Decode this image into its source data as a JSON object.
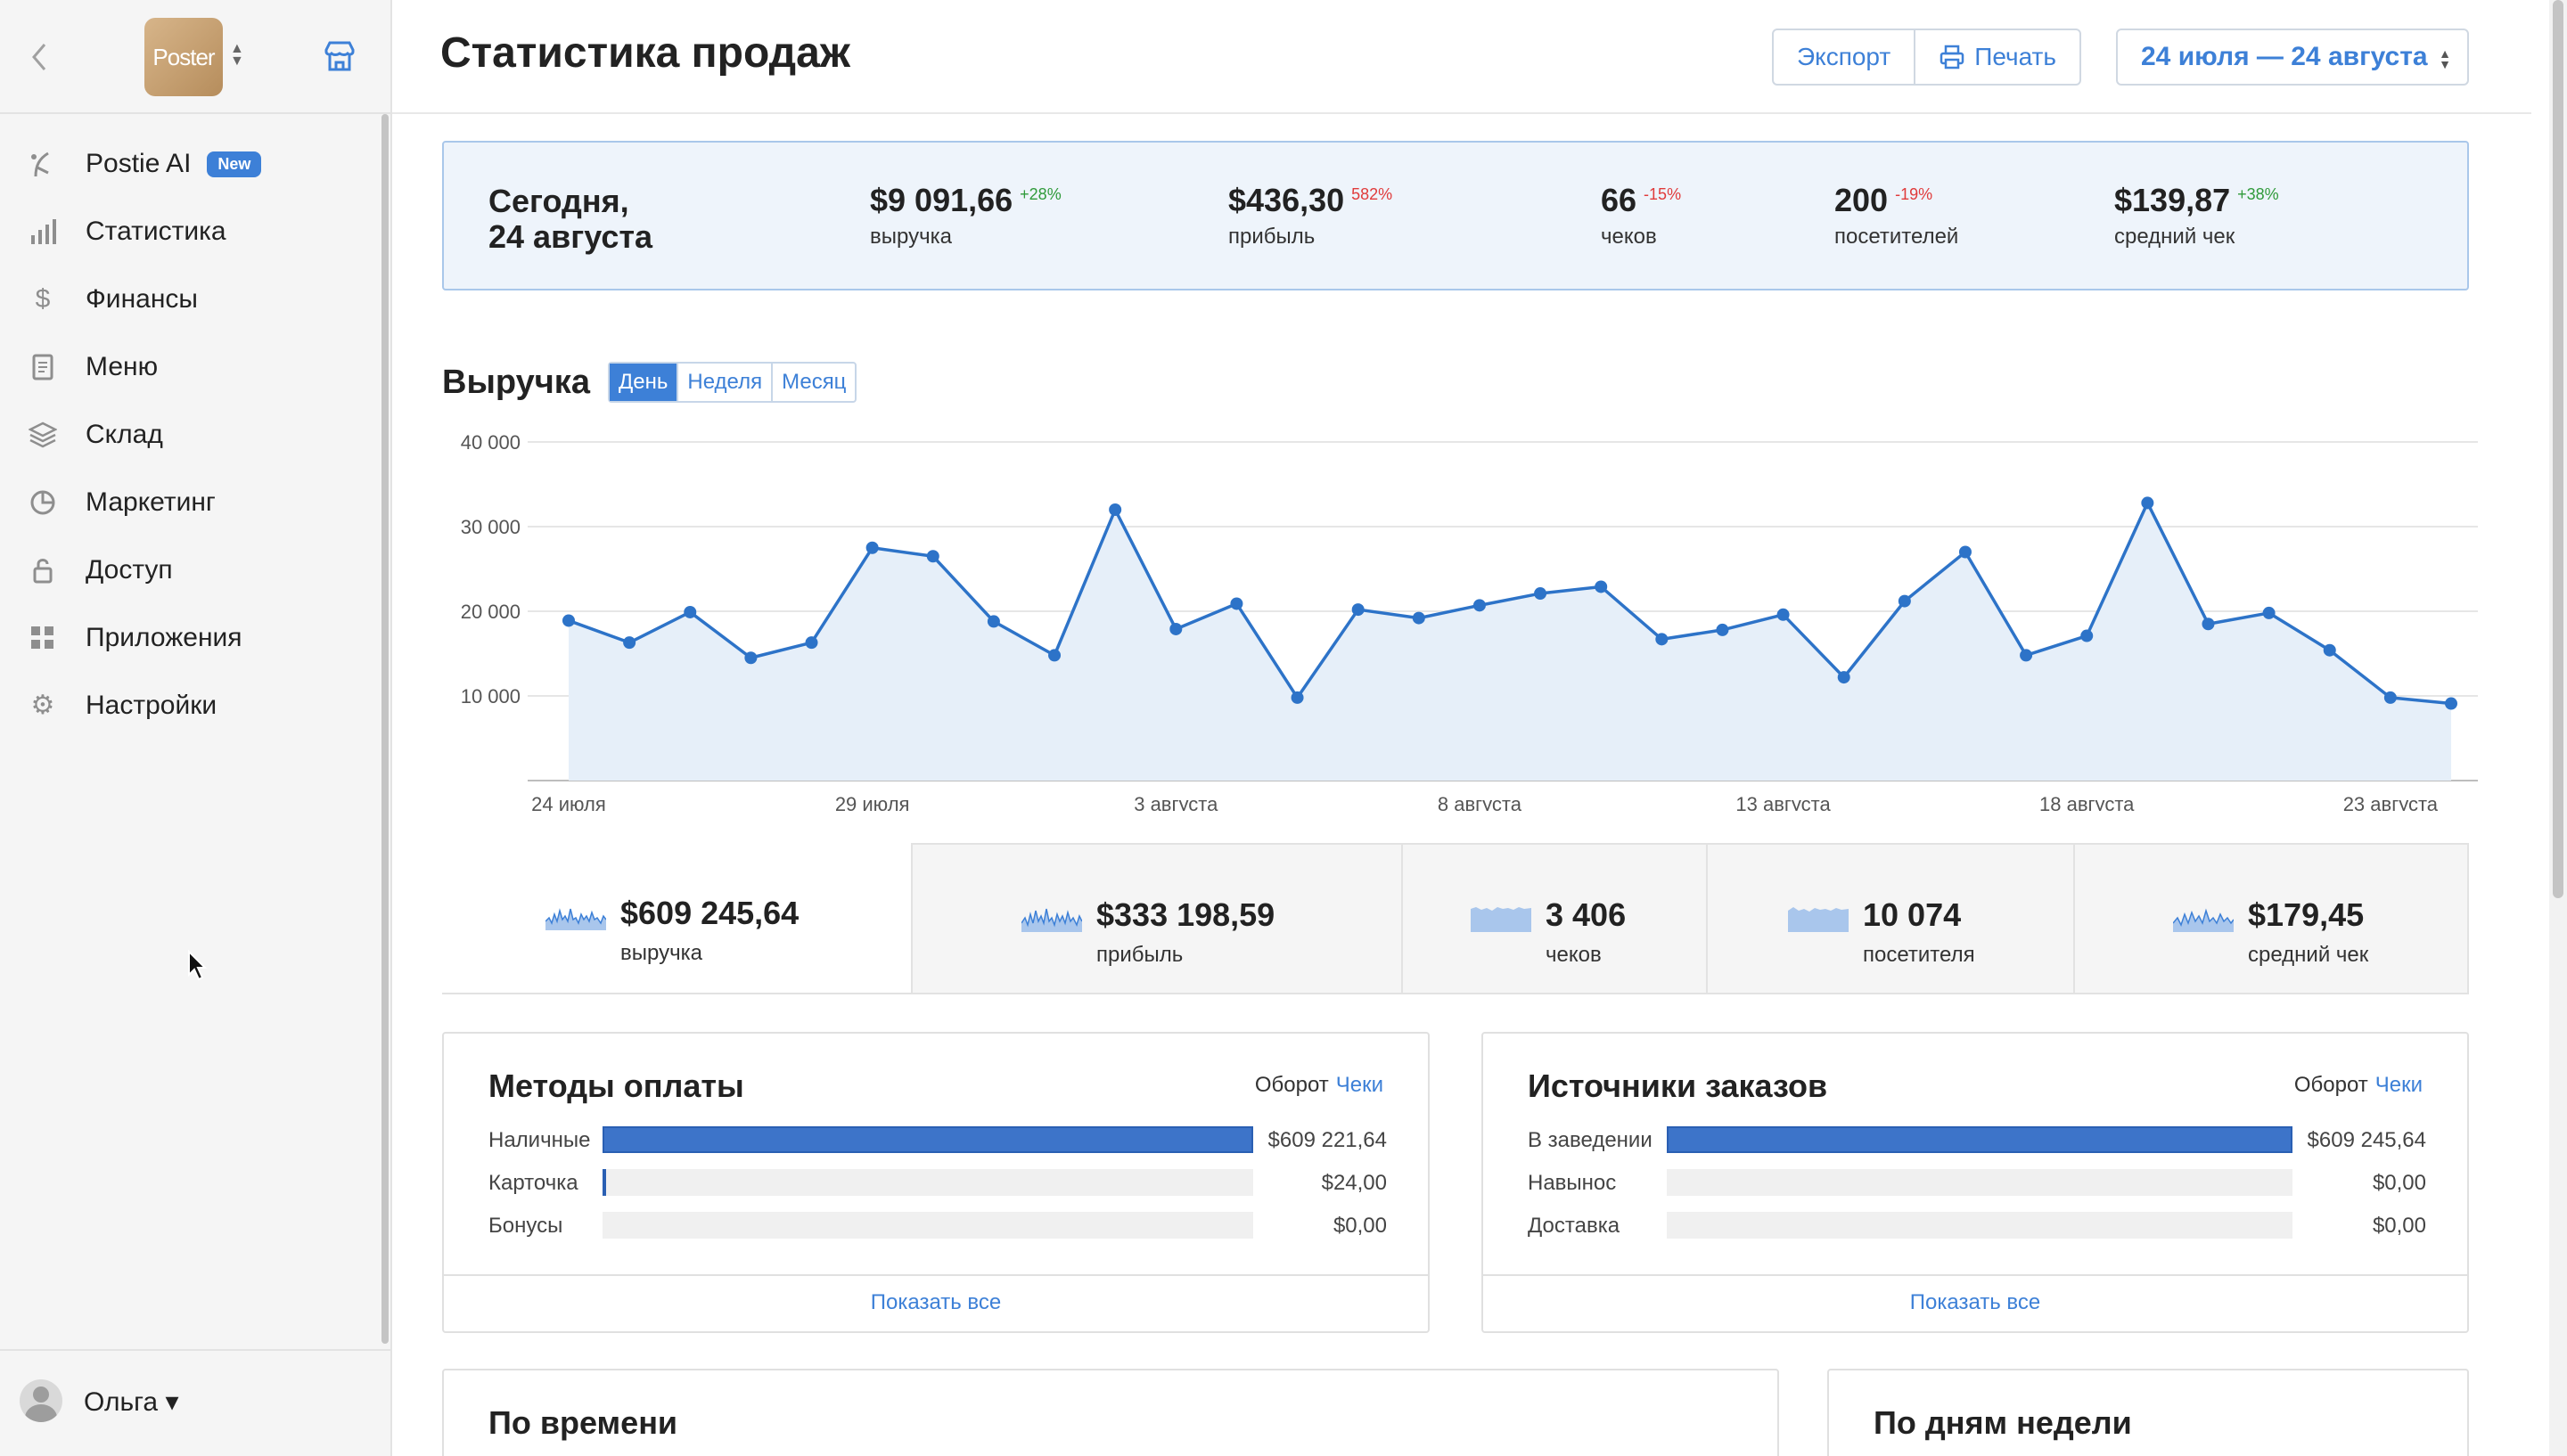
{
  "sidebar": {
    "logo_text": "Poster",
    "items": [
      {
        "label": "Postie AI",
        "icon": "postie-ai-icon",
        "badge": "New"
      },
      {
        "label": "Статистика",
        "icon": "bar-chart-icon"
      },
      {
        "label": "Финансы",
        "icon": "dollar-icon"
      },
      {
        "label": "Меню",
        "icon": "document-icon"
      },
      {
        "label": "Склад",
        "icon": "layers-icon"
      },
      {
        "label": "Маркетинг",
        "icon": "pie-icon"
      },
      {
        "label": "Доступ",
        "icon": "lock-icon"
      },
      {
        "label": "Приложения",
        "icon": "grid-icon"
      },
      {
        "label": "Настройки",
        "icon": "gear-icon"
      }
    ],
    "user": "Ольга"
  },
  "header": {
    "title": "Статистика продаж",
    "export_label": "Экспорт",
    "print_label": "Печать",
    "date_range": "24 июля — 24 августа"
  },
  "today": {
    "date_line1": "Сегодня,",
    "date_line2": "24 августа",
    "kpis": [
      {
        "value": "$9 091,66",
        "pct": "+28%",
        "trend": "up",
        "label": "выручка"
      },
      {
        "value": "$436,30",
        "pct": "582%",
        "trend": "down",
        "label": "прибыль"
      },
      {
        "value": "66",
        "pct": "-15%",
        "trend": "down",
        "label": "чеков"
      },
      {
        "value": "200",
        "pct": "-19%",
        "trend": "down",
        "label": "посетителей"
      },
      {
        "value": "$139,87",
        "pct": "+38%",
        "trend": "up",
        "label": "средний чек"
      }
    ]
  },
  "revenue": {
    "title": "Выручка",
    "periods": [
      "День",
      "Неделя",
      "Месяц"
    ],
    "active_period": "День"
  },
  "chart_data": {
    "type": "area",
    "title": "",
    "xlabel": "",
    "ylabel": "",
    "ylim": [
      0,
      40000
    ],
    "yticks": [
      "10 000",
      "20 000",
      "30 000",
      "40 000"
    ],
    "xticks": [
      "24 июля",
      "29 июля",
      "3 августа",
      "8 августа",
      "13 августа",
      "18 августа",
      "23 августа"
    ],
    "x": [
      "24.07",
      "25.07",
      "26.07",
      "27.07",
      "28.07",
      "29.07",
      "30.07",
      "31.07",
      "01.08",
      "02.08",
      "03.08",
      "04.08",
      "05.08",
      "06.08",
      "07.08",
      "08.08",
      "09.08",
      "10.08",
      "11.08",
      "12.08",
      "13.08",
      "14.08",
      "15.08",
      "16.08",
      "17.08",
      "18.08",
      "19.08",
      "20.08",
      "21.08",
      "22.08",
      "23.08",
      "24.08"
    ],
    "values": [
      18900,
      16300,
      19900,
      14500,
      16300,
      27500,
      26500,
      18800,
      14800,
      32000,
      17900,
      20900,
      9800,
      20200,
      19200,
      20700,
      22100,
      22900,
      16700,
      17800,
      19600,
      12200,
      21200,
      27000,
      14800,
      17100,
      32800,
      18500,
      19800,
      15400,
      9800,
      9100
    ],
    "grid": true,
    "color": "#2d73c8",
    "fill": "#e6eff9"
  },
  "summary": [
    {
      "value": "$609 245,64",
      "label": "выручка"
    },
    {
      "value": "$333 198,59",
      "label": "прибыль"
    },
    {
      "value": "3 406",
      "label": "чеков"
    },
    {
      "value": "10 074",
      "label": "посетителя"
    },
    {
      "value": "$179,45",
      "label": "средний чек"
    }
  ],
  "payments": {
    "title": "Методы оплаты",
    "toggle_a": "Оборот",
    "toggle_b": "Чеки",
    "rows": [
      {
        "label": "Наличные",
        "value": "$609 221,64",
        "fraction": 1.0
      },
      {
        "label": "Карточка",
        "value": "$24,00",
        "fraction": 0.004
      },
      {
        "label": "Бонусы",
        "value": "$0,00",
        "fraction": 0
      }
    ],
    "footer": "Показать все"
  },
  "sources": {
    "title": "Источники заказов",
    "toggle_a": "Оборот",
    "toggle_b": "Чеки",
    "rows": [
      {
        "label": "В заведении",
        "value": "$609 245,64",
        "fraction": 1.0
      },
      {
        "label": "Навынос",
        "value": "$0,00",
        "fraction": 0
      },
      {
        "label": "Доставка",
        "value": "$0,00",
        "fraction": 0
      }
    ],
    "footer": "Показать все"
  },
  "by_time": {
    "title": "По времени"
  },
  "by_weekday": {
    "title": "По дням недели"
  }
}
